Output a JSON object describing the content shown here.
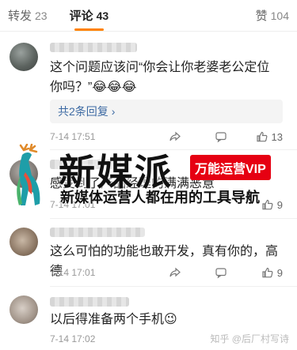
{
  "tabs": {
    "repost": {
      "label": "转发",
      "count": "23"
    },
    "comment": {
      "label": "评论",
      "count": "43"
    },
    "like": {
      "label": "赞",
      "count": "104"
    }
  },
  "comments": [
    {
      "text": "这个问题应该问“你会让你老婆老公定位你吗？”😂😂😂",
      "replies_label": "共2条回复",
      "time": "7-14 17:51",
      "likes": "13"
    },
    {
      "text": "感受到了产品经理的满满恶意",
      "time": "7-14 17:01",
      "likes": "9"
    },
    {
      "text": "这么可怕的功能也敢开发，真有你的，高德",
      "time": "7-14 17:01",
      "likes": "9"
    },
    {
      "text": "以后得准备两个手机😉",
      "time": "7-14 17:02",
      "likes": ""
    }
  ],
  "watermark": {
    "title": "新媒派",
    "badge": "万能运营VIP",
    "subtitle": "新媒体运营人都在用的工具导航"
  },
  "footer_mark": "知乎 @后厂村写诗",
  "colors": {
    "accent": "#ff8200",
    "link": "#3d6aa3",
    "badge": "#e60012"
  }
}
